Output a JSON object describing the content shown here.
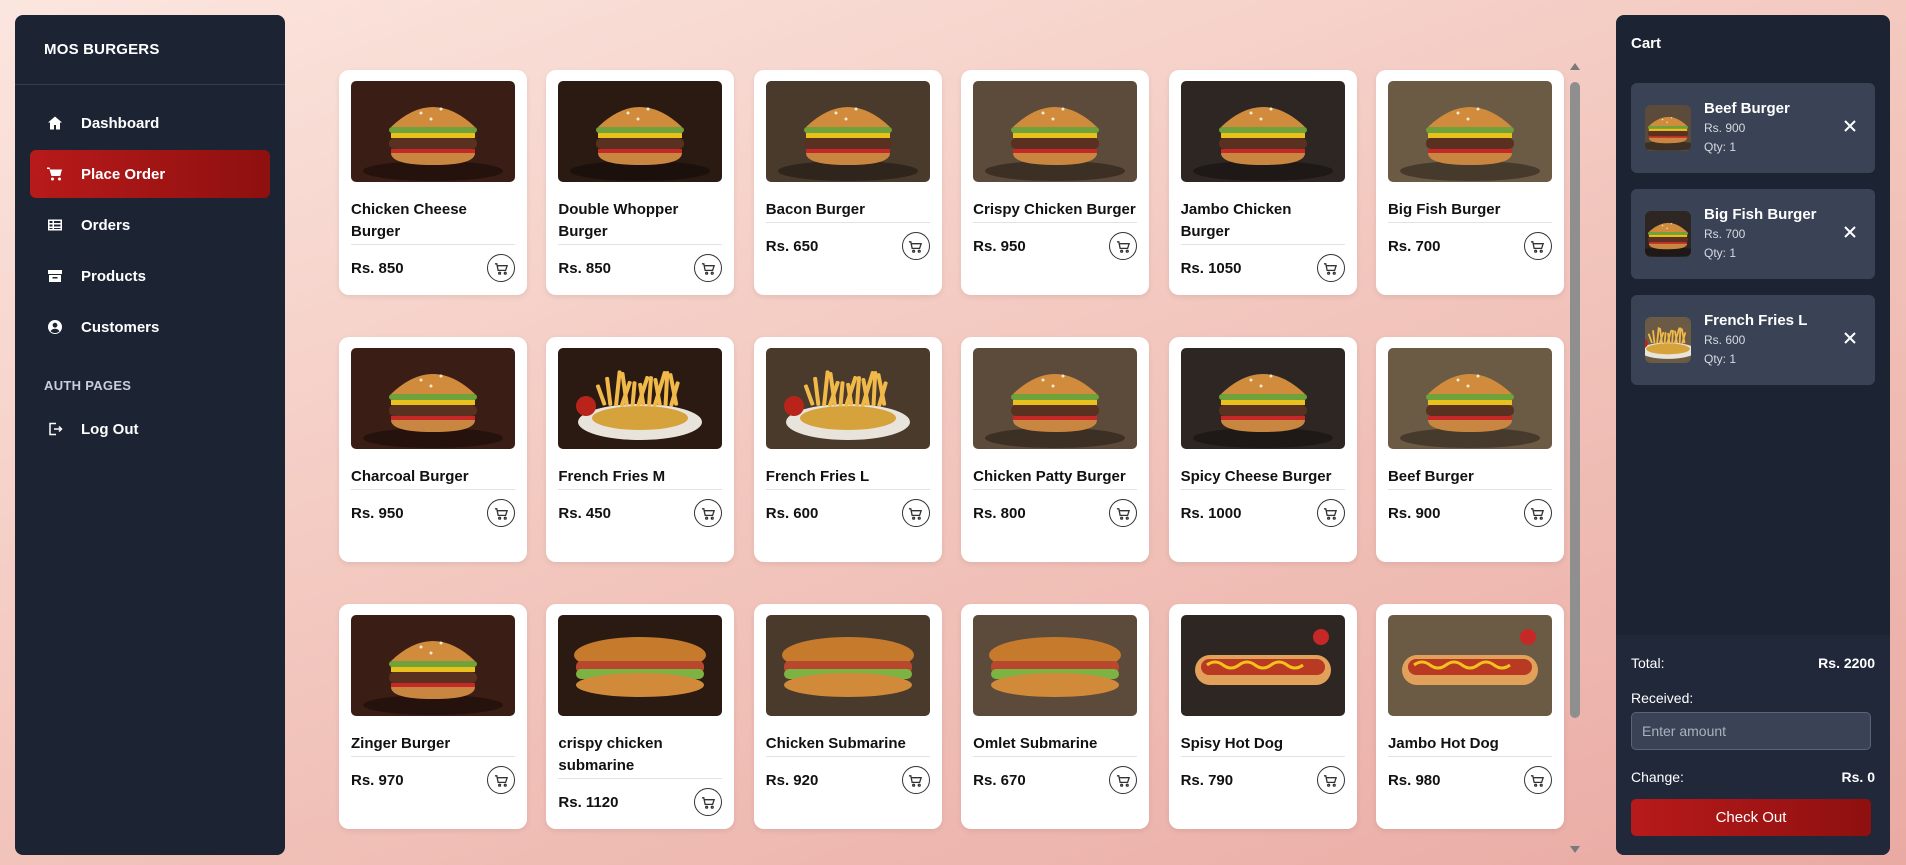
{
  "brand": "MOS BURGERS",
  "nav": {
    "dashboard": "Dashboard",
    "place_order": "Place Order",
    "orders": "Orders",
    "products": "Products",
    "customers": "Customers",
    "auth_section": "AUTH PAGES",
    "logout": "Log Out"
  },
  "products": [
    {
      "name": "Chicken Cheese Burger",
      "price": "Rs. 850",
      "image": "burger-icon"
    },
    {
      "name": "Double Whopper Burger",
      "price": "Rs. 850",
      "image": "burger-icon"
    },
    {
      "name": "Bacon Burger",
      "price": "Rs. 650",
      "image": "burger-icon"
    },
    {
      "name": "Crispy Chicken Burger",
      "price": "Rs. 950",
      "image": "burger-icon"
    },
    {
      "name": "Jambo Chicken Burger",
      "price": "Rs. 1050",
      "image": "burger-icon"
    },
    {
      "name": "Big Fish Burger",
      "price": "Rs. 700",
      "image": "burger-icon"
    },
    {
      "name": "Charcoal Burger",
      "price": "Rs. 950",
      "image": "burger-icon"
    },
    {
      "name": "French Fries M",
      "price": "Rs. 450",
      "image": "fries-icon"
    },
    {
      "name": "French Fries L",
      "price": "Rs. 600",
      "image": "fries-icon"
    },
    {
      "name": "Chicken Patty Burger",
      "price": "Rs. 800",
      "image": "burger-icon"
    },
    {
      "name": "Spicy Cheese Burger",
      "price": "Rs. 1000",
      "image": "burger-icon"
    },
    {
      "name": "Beef Burger",
      "price": "Rs. 900",
      "image": "burger-icon"
    },
    {
      "name": "Zinger Burger",
      "price": "Rs. 970",
      "image": "burger-icon"
    },
    {
      "name": "crispy chicken submarine",
      "price": "Rs. 1120",
      "image": "submarine-icon"
    },
    {
      "name": "Chicken Submarine",
      "price": "Rs. 920",
      "image": "submarine-icon"
    },
    {
      "name": "Omlet Submarine",
      "price": "Rs. 670",
      "image": "submarine-icon"
    },
    {
      "name": "Spisy Hot Dog",
      "price": "Rs. 790",
      "image": "hotdog-icon"
    },
    {
      "name": "Jambo Hot Dog",
      "price": "Rs. 980",
      "image": "hotdog-icon"
    }
  ],
  "cart": {
    "title": "Cart",
    "items": [
      {
        "name": "Beef Burger",
        "price": "Rs. 900",
        "qty": "Qty: 1",
        "image": "burger-icon"
      },
      {
        "name": "Big Fish Burger",
        "price": "Rs. 700",
        "qty": "Qty: 1",
        "image": "burger-icon"
      },
      {
        "name": "French Fries L",
        "price": "Rs. 600",
        "qty": "Qty: 1",
        "image": "fries-icon"
      }
    ],
    "total_label": "Total:",
    "total_value": "Rs. 2200",
    "received_label": "Received:",
    "amount_placeholder": "Enter amount",
    "change_label": "Change:",
    "change_value": "Rs. 0",
    "checkout_label": "Check Out"
  },
  "colors": {
    "sidebar_bg": "#1c2333",
    "accent": "#b81a1a",
    "cart_item_bg": "#3a4356"
  }
}
